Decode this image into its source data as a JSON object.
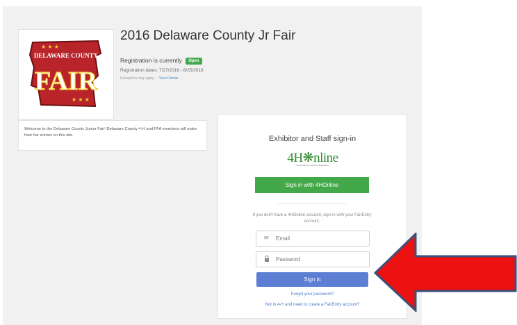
{
  "fair": {
    "title": "2016 Delaware County Jr Fair",
    "registration_label": "Registration is currently",
    "registration_status": "Open",
    "registration_dates": "Registration dates: 7/27/2016 - 8/25/2016",
    "exceptions_text": "Exceptions may apply.",
    "view_details": "View Details",
    "logo_text_top": "DELAWARE COUNTY",
    "logo_text_main": "FAIR"
  },
  "welcome": {
    "message": "Welcome to the Delaware County Junior Fair! Delaware County 4-H and FFA members will make their fair entries on this site."
  },
  "signin": {
    "title": "Exhibitor and Staff sign-in",
    "brand_text": "4H❋nline",
    "brand_subtitle": "4-H Enrollment and Event Registration",
    "btn_4h_label": "Sign in with 4HOnline",
    "info": "If you don't have a 4HOnline account, sign-in with your FairEntry account.",
    "email_placeholder": "Email",
    "password_placeholder": "Password",
    "signin_label": "Sign in",
    "forgot_label": "Forgot your password?",
    "create_label": "Not in 4-H and need to create a FairEntry account?"
  },
  "colors": {
    "open_badge": "#44a84e",
    "btn_4h": "#43a849",
    "btn_signin": "#5c7fd3",
    "arrow": "#ee1111"
  },
  "icons": {
    "email": "envelope-icon",
    "password": "lock-icon",
    "annotation": "red-arrow-icon"
  }
}
